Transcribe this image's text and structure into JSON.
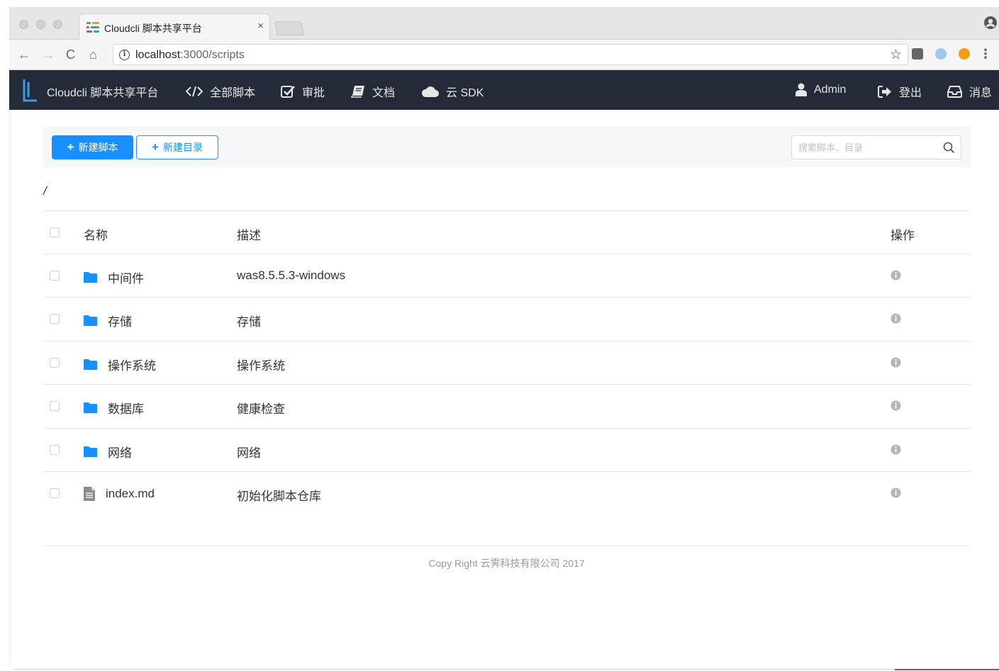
{
  "browser": {
    "tab_title": "Cloudcli 脚本共享平台",
    "tab_close": "×",
    "url_host": "localhost",
    "url_path": ":3000/scripts",
    "back": "←",
    "forward": "→",
    "reload": "C",
    "home": "⌂",
    "bookmark": "☆",
    "menu": "⋮"
  },
  "navbar": {
    "brand": "Cloudcli 脚本共享平台",
    "items": [
      {
        "label": "全部脚本",
        "icon": "code-icon"
      },
      {
        "label": "审批",
        "icon": "check-square-icon"
      },
      {
        "label": "文档",
        "icon": "book-icon"
      },
      {
        "label": "云 SDK",
        "icon": "cloud-icon"
      }
    ],
    "right_items": [
      {
        "label": "Admin",
        "icon": "user-icon"
      },
      {
        "label": "登出",
        "icon": "sign-out-icon"
      },
      {
        "label": "消息",
        "icon": "inbox-icon"
      }
    ]
  },
  "actions": {
    "new_script": "新建脚本",
    "new_folder": "新建目录",
    "plus": "+",
    "search_placeholder": "搜索脚本、目录"
  },
  "breadcrumb": "/",
  "table": {
    "headers": {
      "name": "名称",
      "desc": "描述",
      "op": "操作"
    },
    "rows": [
      {
        "name": "中间件",
        "desc": "was8.5.5.3-windows",
        "type": "folder"
      },
      {
        "name": "存储",
        "desc": "存储",
        "type": "folder"
      },
      {
        "name": "操作系统",
        "desc": "操作系统",
        "type": "folder"
      },
      {
        "name": "数据库",
        "desc": "健康检查",
        "type": "folder"
      },
      {
        "name": "网络",
        "desc": "网络",
        "type": "folder"
      },
      {
        "name": "index.md",
        "desc": "初始化脚本仓库",
        "type": "file"
      }
    ]
  },
  "footer": "Copy Right 云霁科技有限公司 2017",
  "colors": {
    "navbar_bg": "#242a38",
    "primary": "#1890ff",
    "folder": "#1890ff",
    "footer_text": "#9a9a9a"
  }
}
